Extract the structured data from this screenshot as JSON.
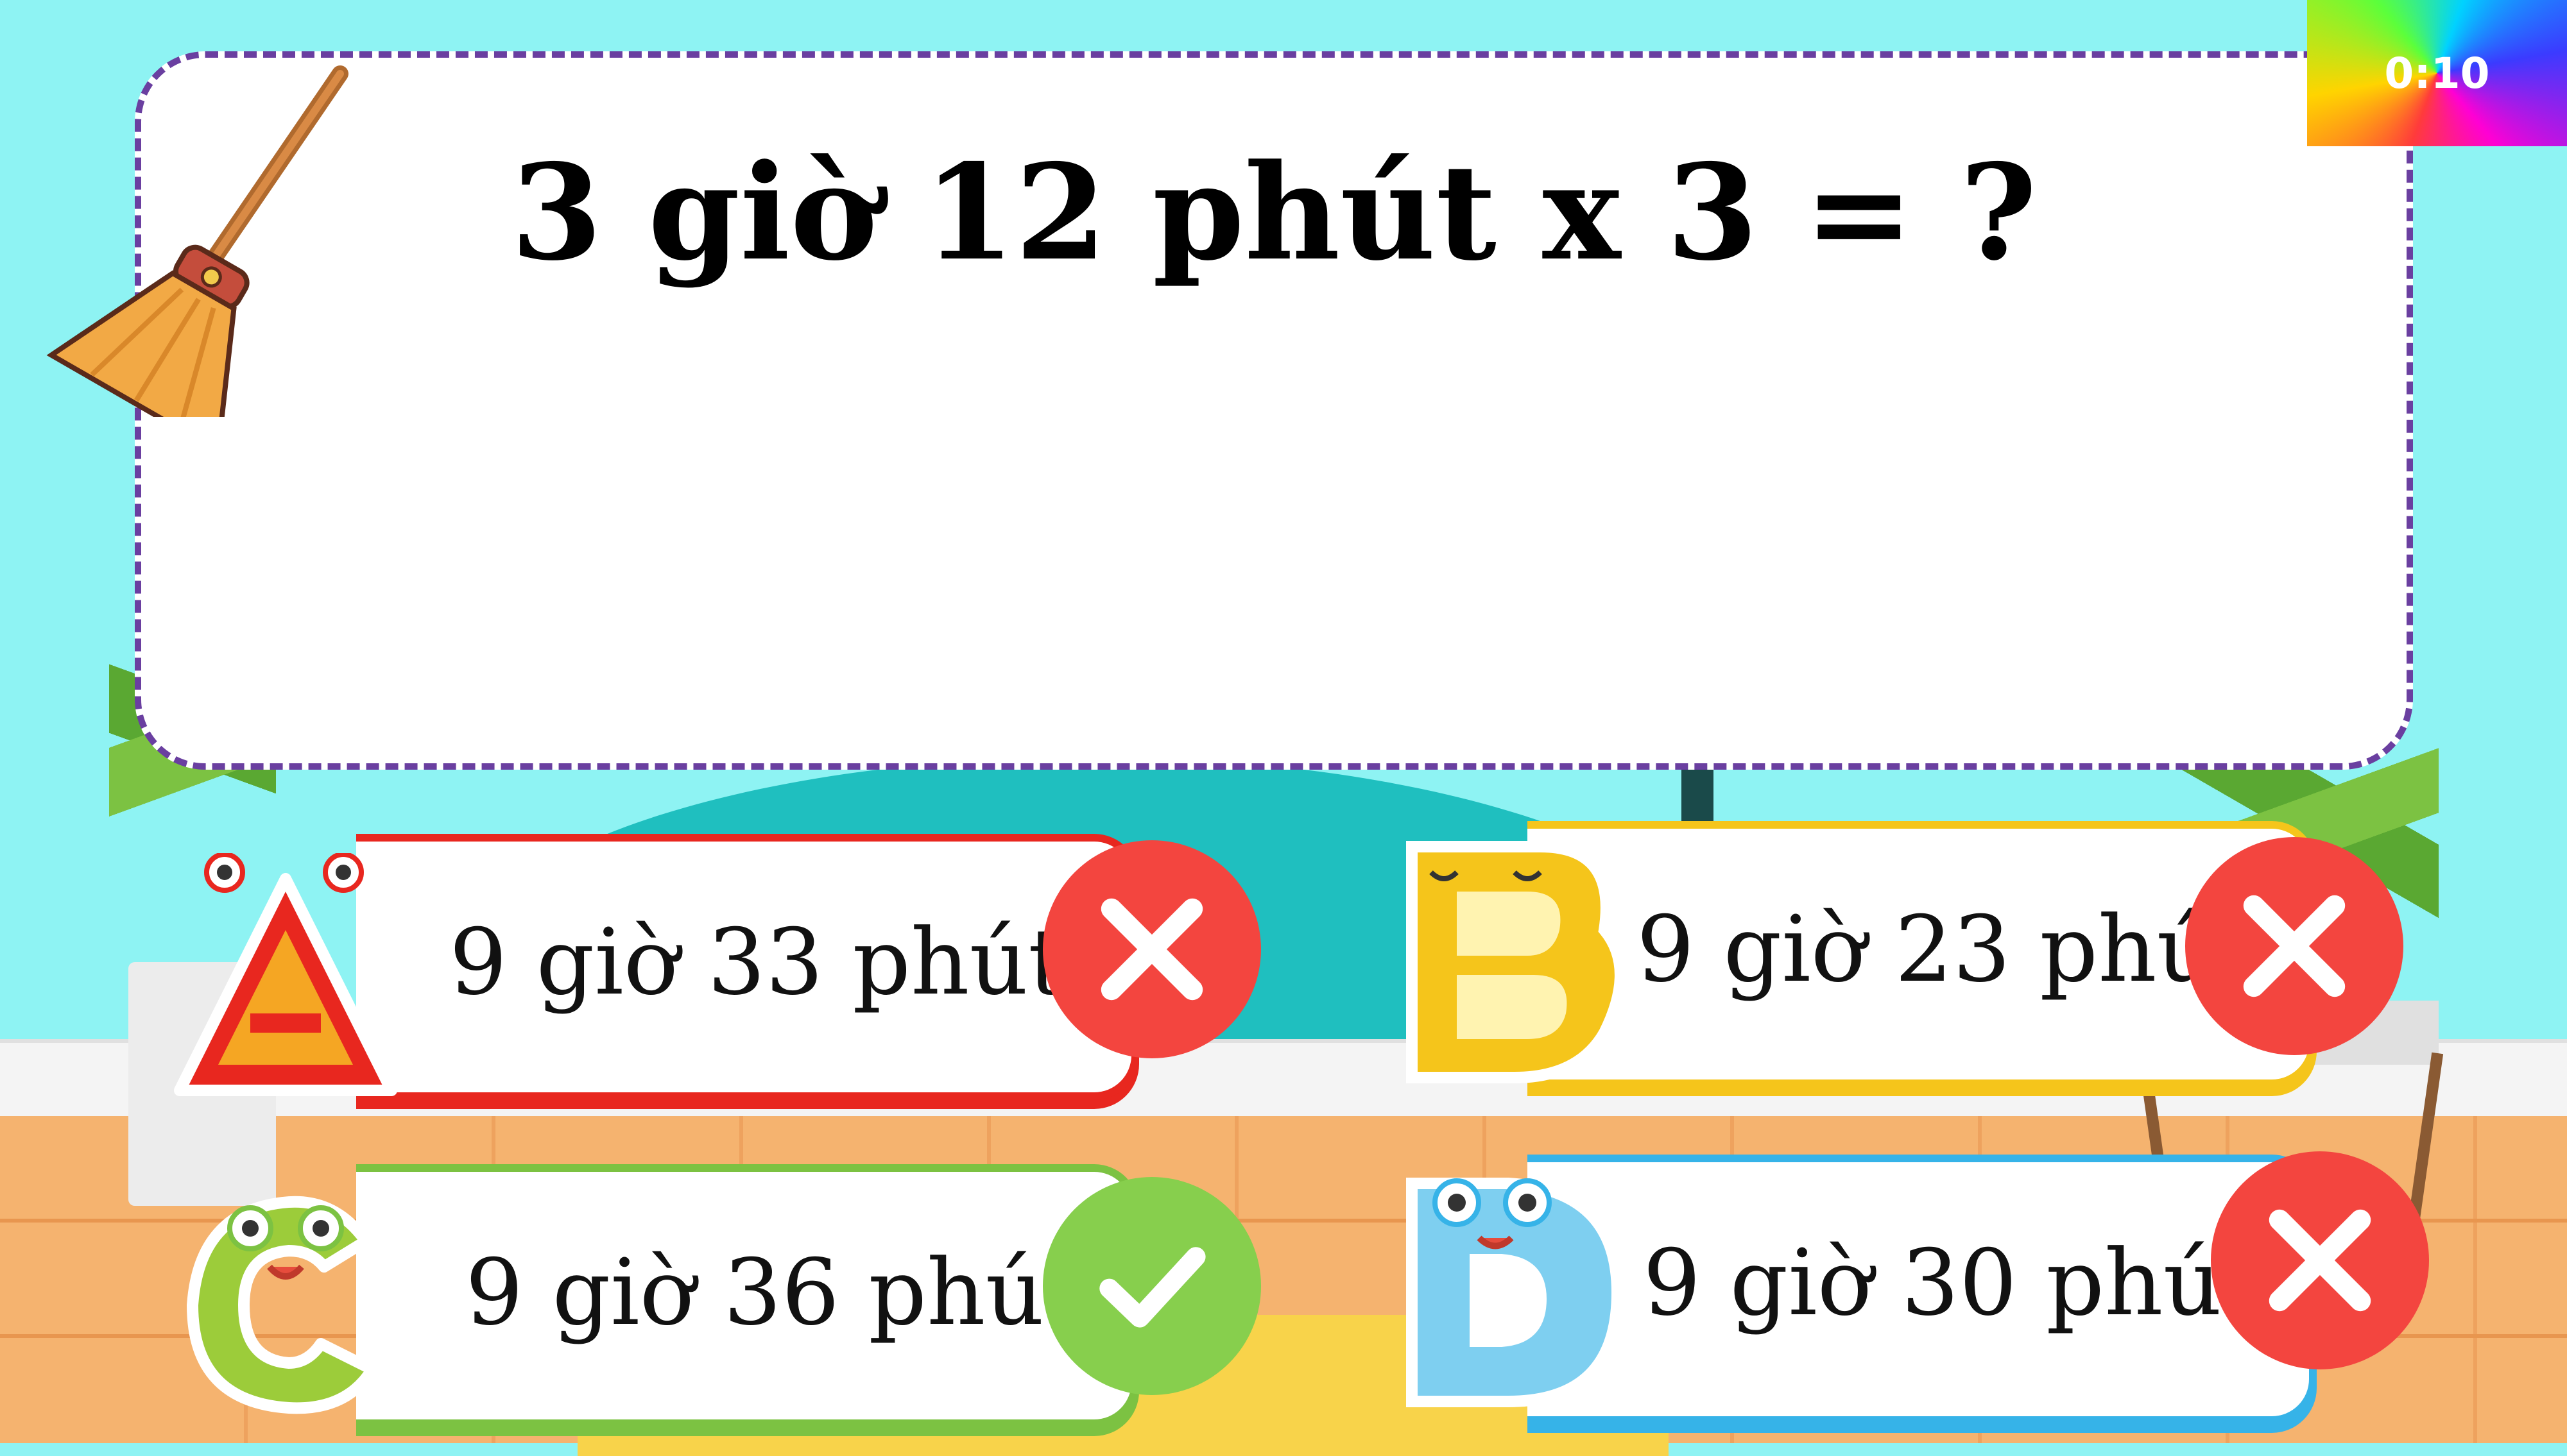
{
  "timer": {
    "label": "0:10"
  },
  "question": {
    "text": "3 giờ 12 phút x 3 = ?"
  },
  "answers": [
    {
      "letter": "A",
      "text": "9 giờ 33 phút",
      "status": "wrong",
      "color": "#e8271f"
    },
    {
      "letter": "B",
      "text": "9 giờ 23 phút",
      "status": "wrong",
      "color": "#f5c51b"
    },
    {
      "letter": "C",
      "text": "9 giờ 36 phút",
      "status": "correct",
      "color": "#7cc242"
    },
    {
      "letter": "D",
      "text": "9 giờ 30 phút",
      "status": "wrong",
      "color": "#36b3e8"
    }
  ],
  "icons": {
    "tool": "broom-icon",
    "wrong": "x-icon",
    "correct": "check-icon"
  },
  "colors": {
    "background": "#8ef3f3",
    "card_border": "#6a3fa0",
    "wrong": "#f3453f",
    "correct": "#87cf4d"
  }
}
